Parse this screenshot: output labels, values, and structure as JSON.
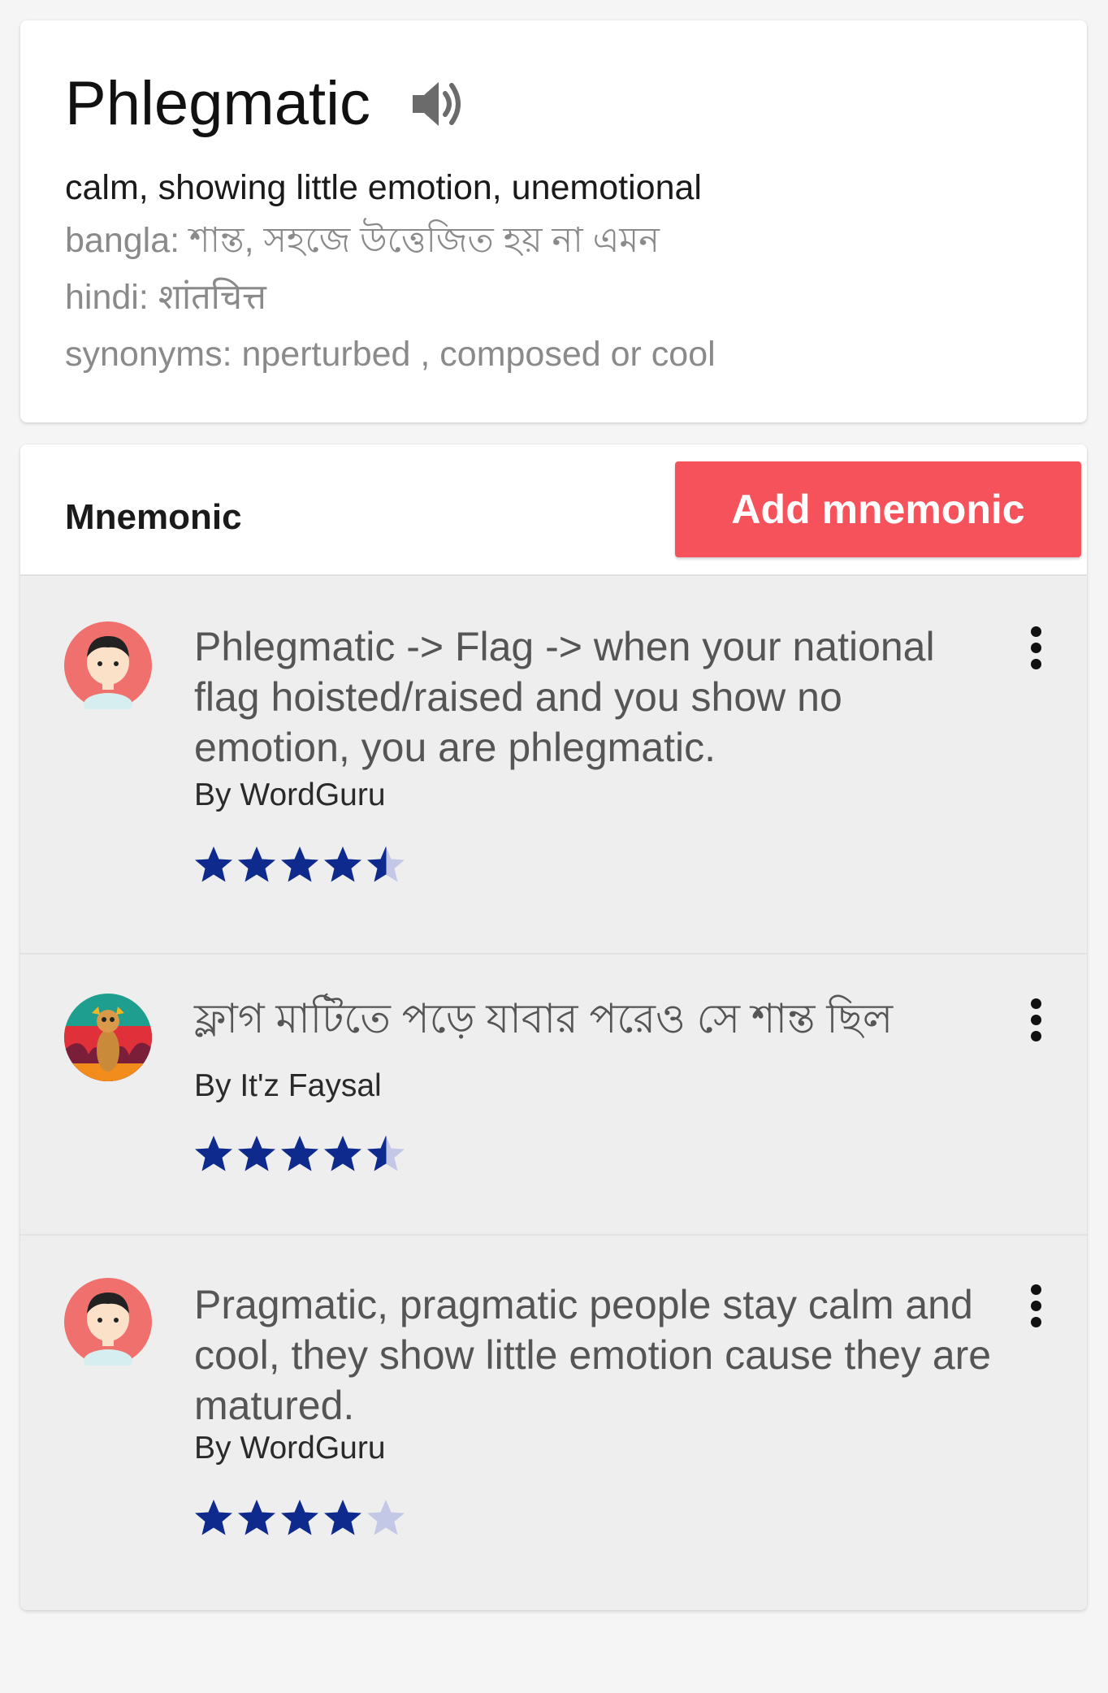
{
  "word": {
    "title": "Phlegmatic",
    "definition": "calm, showing little emotion, unemotional",
    "bangla": "bangla: শান্ত, সহজে উত্তেজিত হয় না এমন",
    "hindi": "hindi: शांतचित्त",
    "synonyms": "synonyms: nperturbed , composed or cool",
    "speaker_icon": "volume-icon"
  },
  "mnemonic": {
    "header_label": "Mnemonic",
    "add_button_label": "Add mnemonic",
    "accent_color": "#f5525c",
    "star_color": "#0d2a8c",
    "items": [
      {
        "text": "Phlegmatic -> Flag -> when your national flag hoisted/raised and you show no emotion, you are phlegmatic.",
        "author": "By WordGuru",
        "rating": 4.5,
        "avatar": "person-avatar"
      },
      {
        "text": "ফ্লাগ মাটিতে পড়ে যাবার পরেও সে শান্ত ছিল",
        "author": "By It'z Faysal",
        "rating": 4.5,
        "avatar": "meerkat-avatar"
      },
      {
        "text": "Pragmatic, pragmatic people stay calm and cool, they show little emotion cause they are matured.",
        "author": "By WordGuru",
        "rating": 4,
        "avatar": "person-avatar"
      }
    ]
  }
}
